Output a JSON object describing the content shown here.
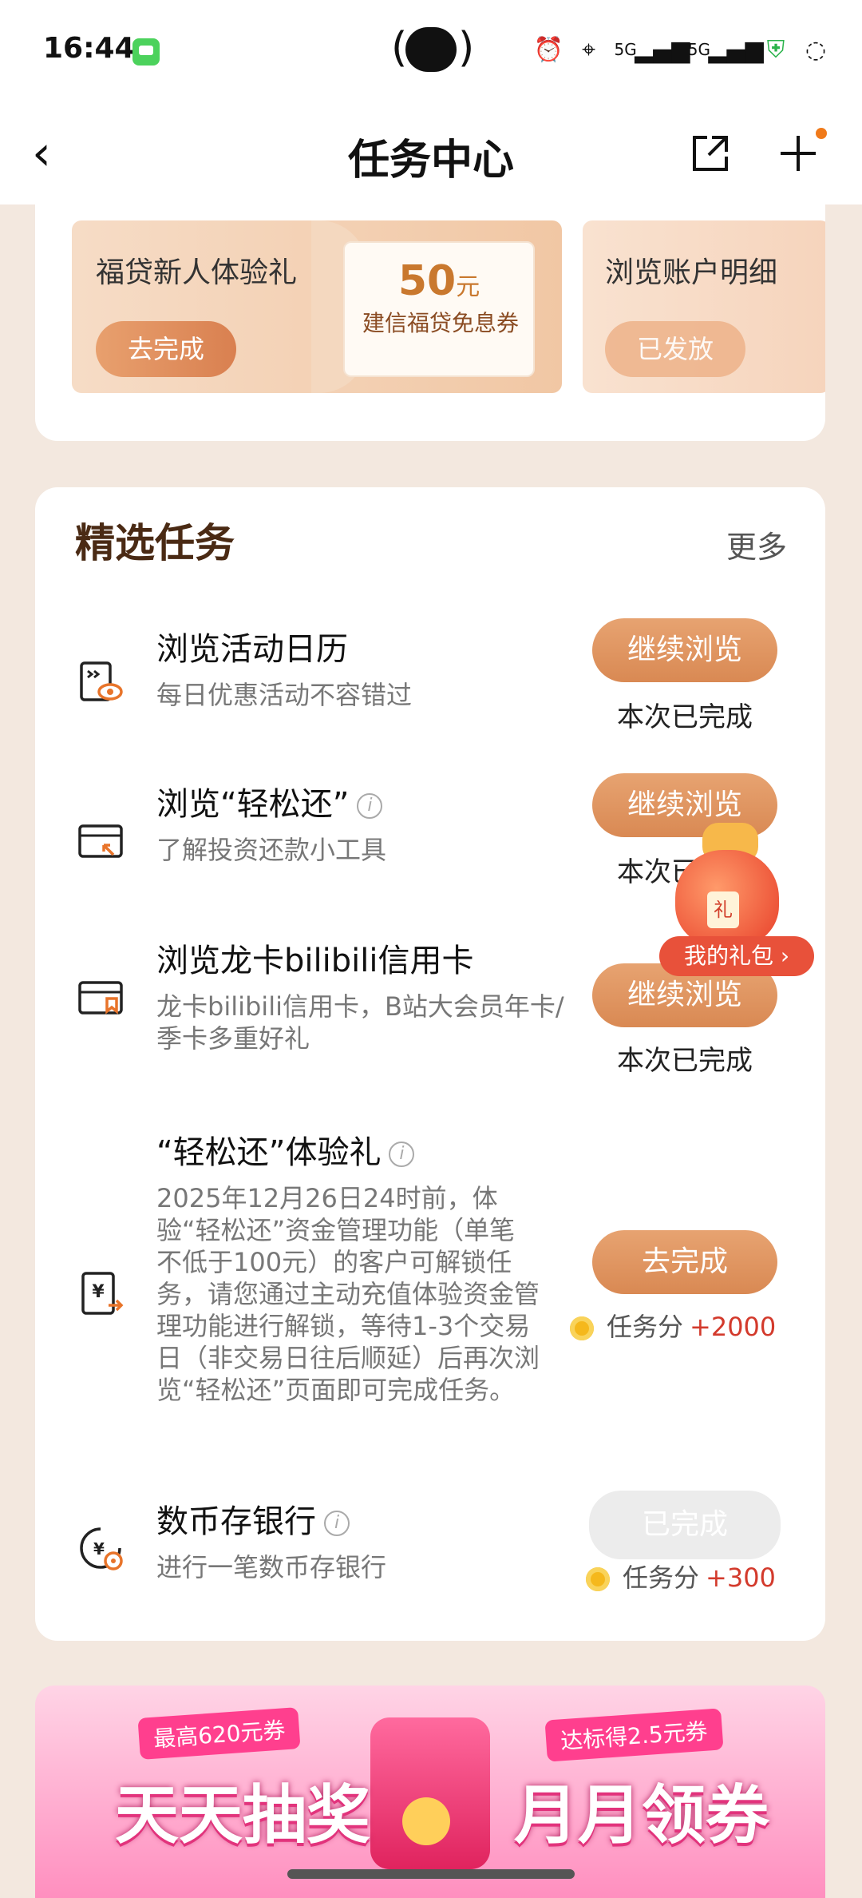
{
  "status_bar": {
    "time": "16:44",
    "network_1": "5G",
    "network_2": "5G"
  },
  "header": {
    "title": "任务中心",
    "back_icon": "chevron-left-icon",
    "share_icon": "share-icon",
    "add_icon": "plus-icon"
  },
  "promos": [
    {
      "label": "福贷新人体验礼",
      "button": "去完成",
      "coupon_amount": "50",
      "coupon_unit": "元",
      "coupon_desc": "建信福贷免息券"
    },
    {
      "label": "浏览账户明细",
      "button": "已发放"
    }
  ],
  "tasks_section": {
    "title": "精选任务",
    "more": "更多",
    "items": [
      {
        "name": "浏览活动日历",
        "desc": "每日优惠活动不容错过",
        "button": "继续浏览",
        "status": "本次已完成"
      },
      {
        "name": "浏览“轻松还”",
        "desc": "了解投资还款小工具",
        "button": "继续浏览",
        "status": "本次已完成"
      },
      {
        "name": "浏览龙卡bilibili信用卡",
        "desc": "龙卡bilibili信用卡，B站大会员年卡/季卡多重好礼",
        "button": "继续浏览",
        "status": "本次已完成"
      },
      {
        "name": "“轻松还”体验礼",
        "desc": "2025年12月26日24时前，体验“轻松还”资金管理功能（单笔不低于100元）的客户可解锁任务，请您通过主动充值体验资金管理功能进行解锁，等待1-3个交易日（非交易日往后顺延）后再次浏览“轻松还”页面即可完成任务。",
        "button": "去完成",
        "score_label": "任务分",
        "score_value": "+2000"
      },
      {
        "name": "数币存银行",
        "desc": "进行一笔数币存银行",
        "button": "已完成",
        "score_label": "任务分",
        "score_value": "+300"
      }
    ]
  },
  "gift_float": {
    "label": "我的礼包 ›",
    "tag": "礼"
  },
  "banner": {
    "left_tag": "最高620元券",
    "left_title": "天天抽奖",
    "right_tag": "达标得2.5元券",
    "right_title": "月月领券"
  },
  "colors": {
    "accent": "#d98953",
    "score_red": "#d33a2c",
    "page_bg": "#f3e8df"
  }
}
